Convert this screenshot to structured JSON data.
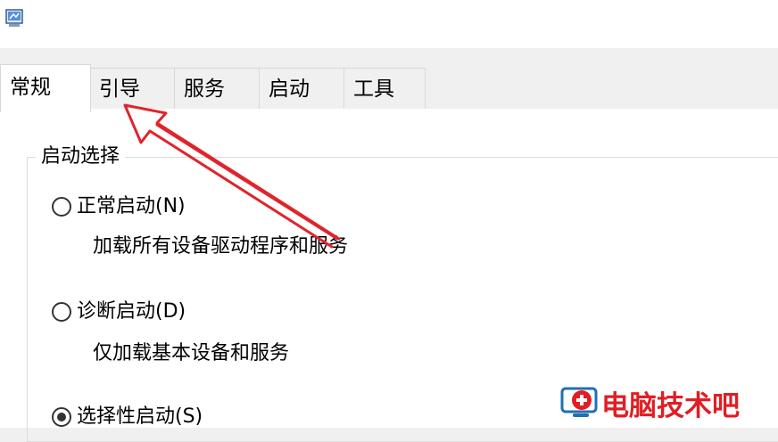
{
  "window": {
    "app_icon": "system-configuration-icon"
  },
  "tabs": [
    {
      "label": "常规",
      "active": true
    },
    {
      "label": "引导",
      "active": false
    },
    {
      "label": "服务",
      "active": false
    },
    {
      "label": "启动",
      "active": false
    },
    {
      "label": "工具",
      "active": false
    }
  ],
  "startup_selection": {
    "title": "启动选择",
    "options": [
      {
        "label": "正常启动(N)",
        "description": "加载所有设备驱动程序和服务",
        "checked": false
      },
      {
        "label": "诊断启动(D)",
        "description": "仅加载基本设备和服务",
        "checked": false
      },
      {
        "label": "选择性启动(S)",
        "checked": true
      }
    ]
  },
  "annotation": {
    "arrow_color": "#e0242b"
  },
  "watermark": {
    "text": "电脑技术吧",
    "icon": "monitor-plus-logo-icon",
    "color": "#e01e24"
  }
}
